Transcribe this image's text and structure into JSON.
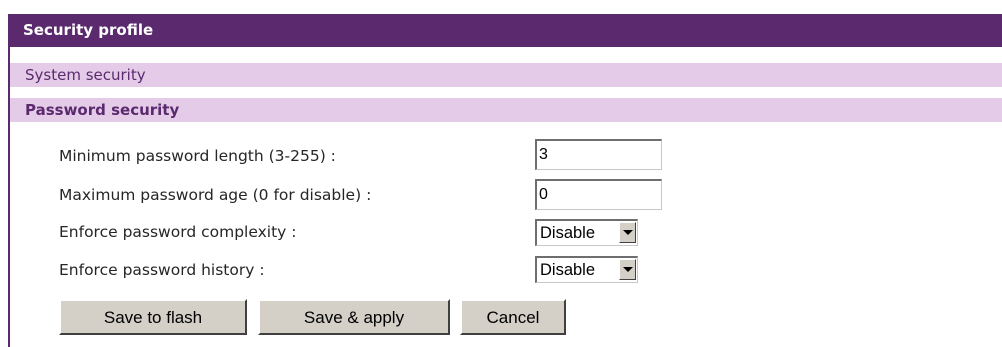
{
  "header": {
    "title": "Security profile"
  },
  "sections": {
    "system_security": "System security",
    "password_security": "Password security"
  },
  "form": {
    "min_length_label": "Minimum password length (3-255) :",
    "min_length_value": "3",
    "max_age_label": "Maximum password age (0 for disable) :",
    "max_age_value": "0",
    "complexity_label": "Enforce password complexity :",
    "complexity_value": "Disable",
    "history_label": "Enforce password history :",
    "history_value": "Disable"
  },
  "buttons": {
    "save_flash": "Save to flash",
    "save_apply": "Save & apply",
    "cancel": "Cancel"
  },
  "colors": {
    "header_bg": "#5b2a6e",
    "section_bg": "#e4cce8",
    "section_text": "#5b2a6e"
  }
}
